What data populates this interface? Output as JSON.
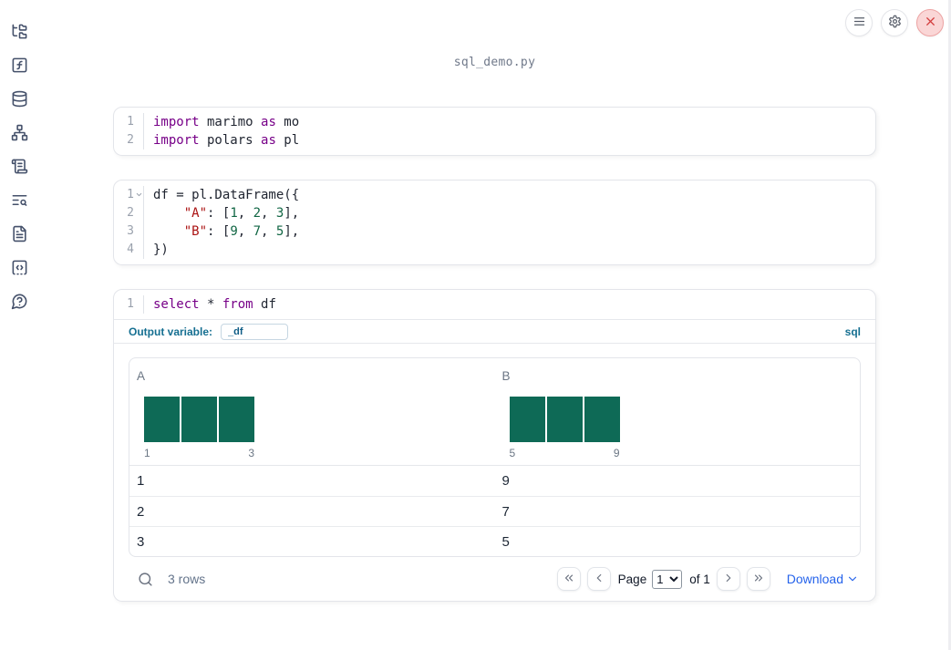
{
  "title": "sql_demo.py",
  "topbar": {
    "buttons": [
      {
        "id": "notebook-menu",
        "icon": "hamburger-icon"
      },
      {
        "id": "settings",
        "icon": "gear-icon"
      },
      {
        "id": "shutdown",
        "icon": "close-icon"
      }
    ]
  },
  "sidebar": {
    "items": [
      {
        "id": "files",
        "icon": "folder-tree-icon"
      },
      {
        "id": "variables",
        "icon": "function-square-icon"
      },
      {
        "id": "data-sources",
        "icon": "database-icon"
      },
      {
        "id": "dependencies",
        "icon": "network-graph-icon"
      },
      {
        "id": "logs",
        "icon": "scroll-text-icon"
      },
      {
        "id": "outline",
        "icon": "text-search-icon"
      },
      {
        "id": "documentation",
        "icon": "file-text-icon"
      },
      {
        "id": "snippets",
        "icon": "code-square-icon"
      },
      {
        "id": "help",
        "icon": "message-question-icon"
      }
    ]
  },
  "colors": {
    "keyword": "#770088",
    "string": "#aa1111",
    "number": "#116644",
    "histogram_bar": "#0e6a56",
    "accent_blue": "#156f91",
    "link_blue": "#2563eb",
    "shutdown_red": "#d33e3e"
  },
  "cells": [
    {
      "lines": [
        {
          "num": "1",
          "tokens": [
            [
              "import",
              "kw"
            ],
            [
              " marimo ",
              "pl"
            ],
            [
              "as",
              "kw"
            ],
            [
              " mo",
              "pl"
            ]
          ]
        },
        {
          "num": "2",
          "tokens": [
            [
              "import",
              "kw"
            ],
            [
              " polars ",
              "pl"
            ],
            [
              "as",
              "kw"
            ],
            [
              " pl",
              "pl"
            ]
          ]
        }
      ]
    },
    {
      "lines": [
        {
          "num": "1",
          "fold": true,
          "tokens": [
            [
              "df = pl.DataFrame({",
              "pl"
            ]
          ]
        },
        {
          "num": "2",
          "tokens": [
            [
              "    ",
              "pl"
            ],
            [
              "\"A\"",
              "str"
            ],
            [
              ": [",
              "pl"
            ],
            [
              "1",
              "num"
            ],
            [
              ", ",
              "pl"
            ],
            [
              "2",
              "num"
            ],
            [
              ", ",
              "pl"
            ],
            [
              "3",
              "num"
            ],
            [
              "],",
              "pl"
            ]
          ]
        },
        {
          "num": "3",
          "tokens": [
            [
              "    ",
              "pl"
            ],
            [
              "\"B\"",
              "str"
            ],
            [
              ": [",
              "pl"
            ],
            [
              "9",
              "num"
            ],
            [
              ", ",
              "pl"
            ],
            [
              "7",
              "num"
            ],
            [
              ", ",
              "pl"
            ],
            [
              "5",
              "num"
            ],
            [
              "],",
              "pl"
            ]
          ]
        },
        {
          "num": "4",
          "tokens": [
            [
              "})",
              "pl"
            ]
          ]
        }
      ]
    }
  ],
  "sql_cell": {
    "lines": [
      {
        "num": "1",
        "tokens": [
          [
            "select",
            "kw"
          ],
          [
            " * ",
            "pl"
          ],
          [
            "from",
            "kw"
          ],
          [
            " df",
            "pl"
          ]
        ]
      }
    ],
    "output_variable_label": "Output variable:",
    "output_variable_value": "_df",
    "language_badge": "sql"
  },
  "table": {
    "columns": [
      {
        "name": "A",
        "histogram": {
          "type": "bar",
          "bars": [
            1,
            1,
            1
          ],
          "x_min_label": "1",
          "x_max_label": "3"
        }
      },
      {
        "name": "B",
        "histogram": {
          "type": "bar",
          "bars": [
            1,
            1,
            1
          ],
          "x_min_label": "5",
          "x_max_label": "9"
        }
      }
    ],
    "rows": [
      [
        "1",
        "9"
      ],
      [
        "2",
        "7"
      ],
      [
        "3",
        "5"
      ]
    ],
    "footer": {
      "row_count": "3 rows",
      "page_label": "Page",
      "page_value": "1",
      "page_total": "of 1",
      "download_label": "Download"
    }
  }
}
